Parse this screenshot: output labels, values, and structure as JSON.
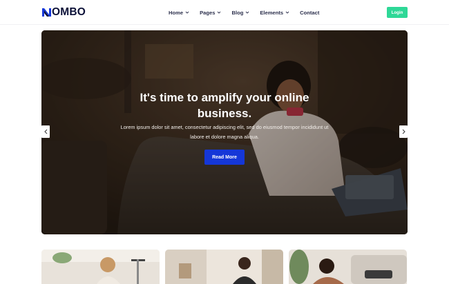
{
  "header": {
    "logo_text": "OMBO",
    "logo_mark": "logo-n-mark",
    "nav": [
      {
        "label": "Home",
        "has_dropdown": true
      },
      {
        "label": "Pages",
        "has_dropdown": true
      },
      {
        "label": "Blog",
        "has_dropdown": true
      },
      {
        "label": "Elements",
        "has_dropdown": true
      },
      {
        "label": "Contact",
        "has_dropdown": false
      }
    ],
    "login_label": "Login"
  },
  "hero": {
    "title": "It's time to amplify your online business.",
    "text": "Lorem ipsum dolor sit amet, consectetur adipiscing elit, sed do eiusmod tempor incididunt ut labore et dolore magna aliqua.",
    "button_label": "Read More",
    "prev_icon": "chevron-left-icon",
    "next_icon": "chevron-right-icon"
  },
  "colors": {
    "brand_dark": "#0c1138",
    "brand_blue": "#1537d8",
    "login_green": "#2ed897"
  }
}
